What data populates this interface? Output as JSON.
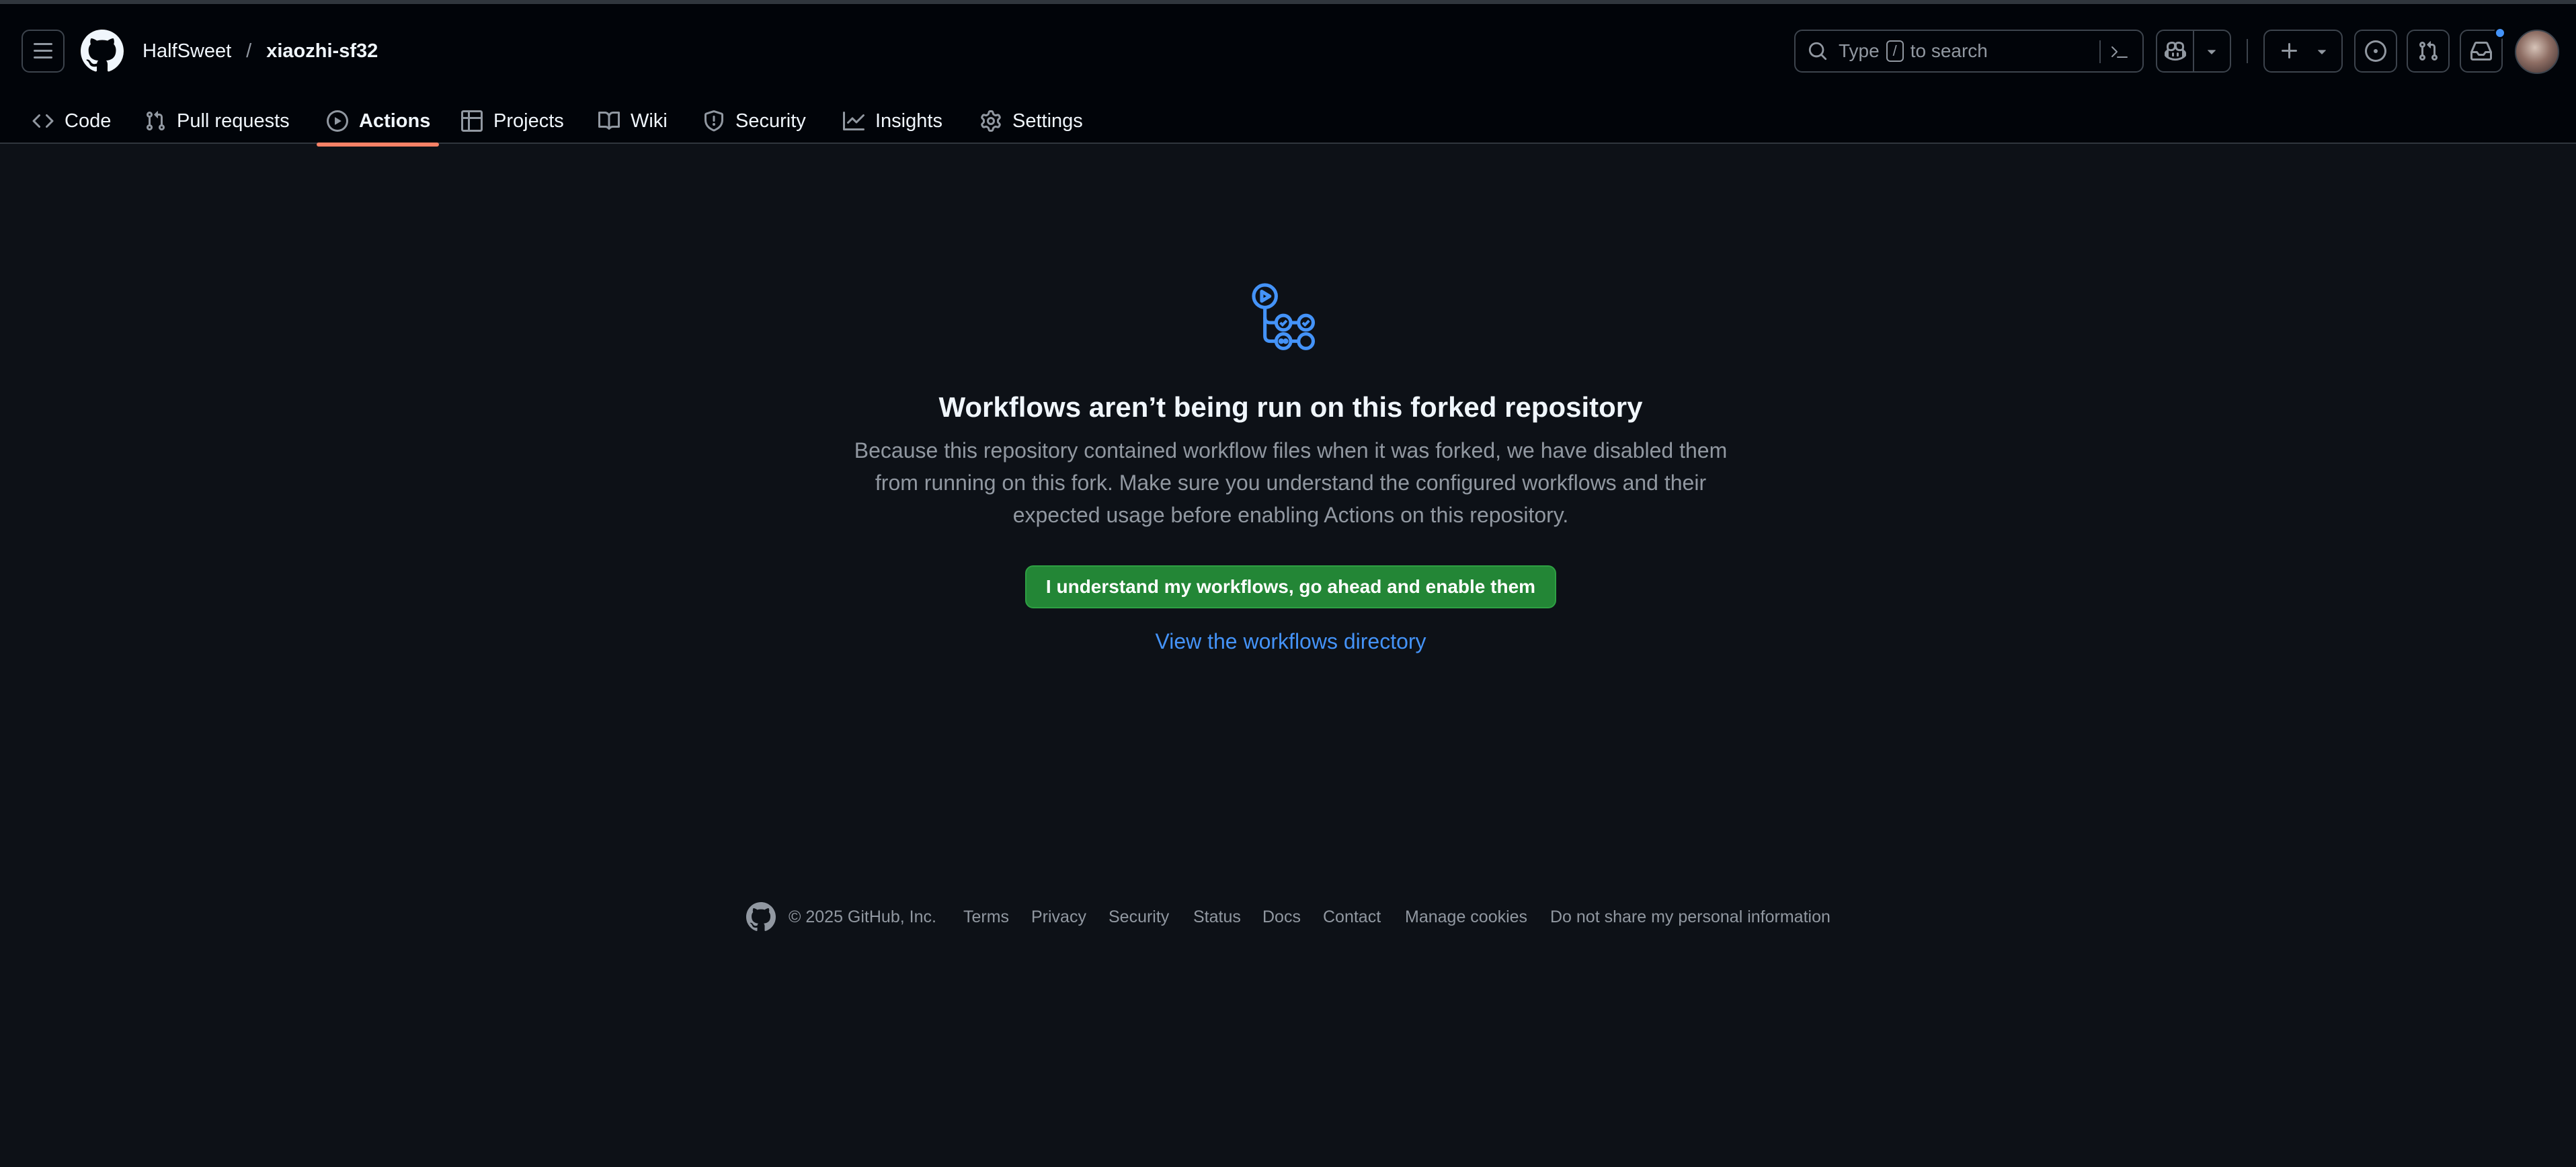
{
  "header": {
    "owner": "HalfSweet",
    "separator": "/",
    "repo": "xiaozhi-sf32",
    "search": {
      "prefix": "Type",
      "key": "/",
      "suffix": "to search"
    }
  },
  "nav": {
    "tabs": [
      {
        "label": "Code",
        "icon": "code-icon"
      },
      {
        "label": "Pull requests",
        "icon": "git-pull-request-icon"
      },
      {
        "label": "Actions",
        "icon": "play-icon",
        "active": true
      },
      {
        "label": "Projects",
        "icon": "table-icon"
      },
      {
        "label": "Wiki",
        "icon": "book-icon"
      },
      {
        "label": "Security",
        "icon": "shield-icon"
      },
      {
        "label": "Insights",
        "icon": "graph-icon"
      },
      {
        "label": "Settings",
        "icon": "gear-icon"
      }
    ]
  },
  "main": {
    "title": "Workflows aren’t being run on this forked repository",
    "description_lines": [
      "Because this repository contained workflow files when it was forked, we have disabled them",
      "from running on this fork. Make sure you understand the configured workflows and their",
      "expected usage before enabling Actions on this repository."
    ],
    "enable_button": "I understand my workflows, go ahead and enable them",
    "directory_link": "View the workflows directory"
  },
  "footer": {
    "copyright": "© 2025 GitHub, Inc.",
    "links": [
      "Terms",
      "Privacy",
      "Security",
      "Status",
      "Docs",
      "Contact",
      "Manage cookies",
      "Do not share my personal information"
    ]
  },
  "colors": {
    "background": "#0d1117",
    "header_bg": "#010409",
    "accent_link": "#4493f8",
    "active_tab_underline": "#f78166",
    "primary_button": "#238636",
    "muted_text": "#9198a1"
  }
}
